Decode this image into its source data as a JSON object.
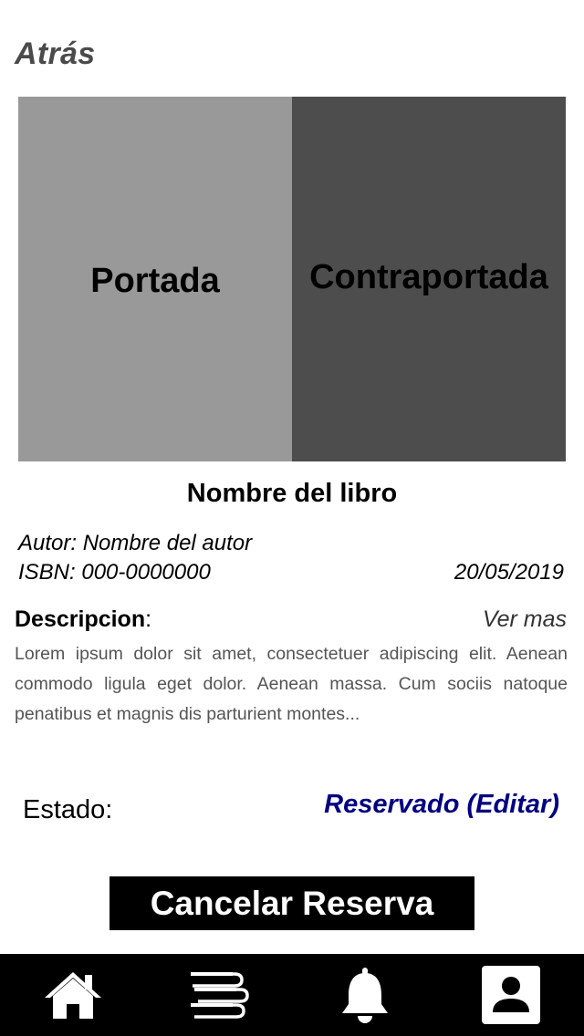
{
  "header": {
    "back_label": "Atrás"
  },
  "images": {
    "front_label": "Portada",
    "back_label": "Contraportada"
  },
  "book": {
    "title": "Nombre del libro",
    "author_line": "Autor: Nombre del autor",
    "isbn_line": "ISBN: 000-0000000",
    "date": "20/05/2019"
  },
  "description": {
    "label": "Descripcion",
    "colon": ":",
    "see_more": "Ver mas",
    "text": "Lorem ipsum dolor sit amet, consectetuer adipiscing elit. Aenean commodo ligula eget dolor. Aenean massa. Cum sociis natoque penatibus et magnis dis parturient montes..."
  },
  "status": {
    "label": "Estado:",
    "value": "Reservado (Editar)",
    "value_color": "#000080"
  },
  "actions": {
    "cancel_label": "Cancelar Reserva"
  },
  "nav": {
    "items": [
      {
        "icon": "home-icon"
      },
      {
        "icon": "books-icon"
      },
      {
        "icon": "bell-icon"
      },
      {
        "icon": "profile-icon"
      }
    ]
  },
  "colors": {
    "front_cover": "#999999",
    "back_cover": "#4d4d4d",
    "nav_background": "#000000",
    "button_background": "#000000"
  }
}
